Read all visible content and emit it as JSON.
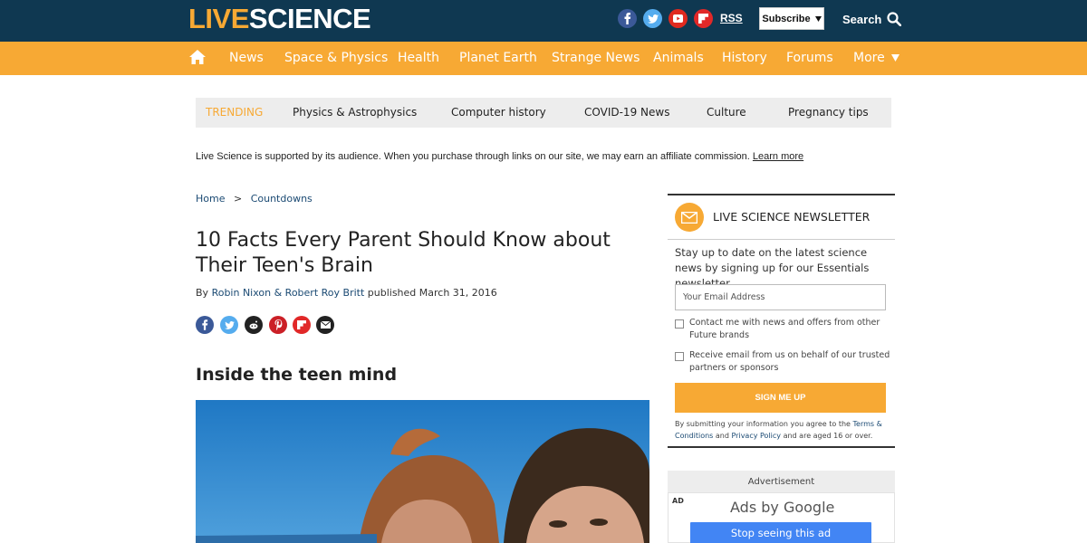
{
  "header": {
    "logo_live": "LIVE",
    "logo_science": "SCIENCE",
    "rss_label": "RSS",
    "subscribe_label": "Subscribe",
    "search_label": "Search",
    "social_icons": [
      "facebook-icon",
      "twitter-icon",
      "youtube-icon",
      "flipboard-icon"
    ]
  },
  "nav": {
    "items": [
      "News",
      "Space & Physics",
      "Health",
      "Planet Earth",
      "Strange News",
      "Animals",
      "History",
      "Forums",
      "More"
    ]
  },
  "trending": {
    "label": "TRENDING",
    "items": [
      "Physics & Astrophysics",
      "Computer history",
      "COVID-19 News",
      "Culture",
      "Pregnancy tips"
    ]
  },
  "affiliate": {
    "text": "Live Science is supported by its audience. When you purchase through links on our site, we may earn an affiliate commission.",
    "link": "Learn more"
  },
  "article": {
    "breadcrumb": [
      "Home",
      "Countdowns"
    ],
    "breadcrumb_sep": ">",
    "title": "10 Facts Every Parent Should Know about Their Teen's Brain",
    "byline_prefix": "By",
    "authors": "Robin Nixon & Robert Roy Britt",
    "published": "published March 31, 2016",
    "subhead": "Inside the teen mind",
    "share_icons": [
      "facebook-icon",
      "twitter-icon",
      "reddit-icon",
      "pinterest-icon",
      "flipboard-icon",
      "email-icon"
    ]
  },
  "newsletter": {
    "title": "LIVE SCIENCE NEWSLETTER",
    "description": "Stay up to date on the latest science news by signing up for our Essentials newsletter.",
    "email_placeholder": "Your Email Address",
    "check1": "Contact me with news and offers from other Future brands",
    "check2": "Receive email from us on behalf of our trusted partners or sponsors",
    "button": "SIGN ME UP",
    "legal_prefix": "By submitting your information you agree to the",
    "legal_link1": "Terms & Conditions",
    "legal_and": "and",
    "legal_link2": "Privacy Policy",
    "legal_suffix": "and are aged 16 or over."
  },
  "ad": {
    "label": "Advertisement",
    "badge": "AD",
    "ads_by": "Ads by Google",
    "stop": "Stop seeing this ad"
  },
  "colors": {
    "header_bg": "#0f3851",
    "accent": "#f7a934",
    "link": "#1b4a73"
  }
}
